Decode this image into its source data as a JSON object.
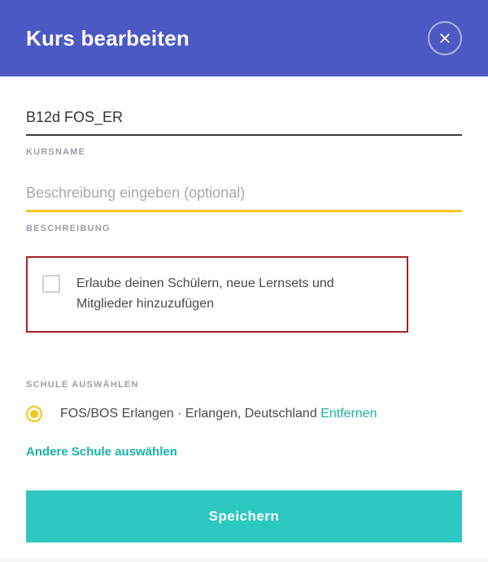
{
  "header": {
    "title": "Kurs bearbeiten"
  },
  "fields": {
    "coursename": {
      "value": "B12d FOS_ER",
      "label": "KURSNAME"
    },
    "description": {
      "value": "",
      "placeholder": "Beschreibung eingeben (optional)",
      "label": "BESCHREIBUNG"
    }
  },
  "permission": {
    "text": "Erlaube deinen Schülern, neue Lernsets und Mitglieder hinzuzufügen"
  },
  "school": {
    "section_label": "SCHULE AUSWÄHLEN",
    "name": "FOS/BOS Erlangen · Erlangen, Deutschland ",
    "remove_label": "Entfernen",
    "other_label": "Andere Schule auswählen"
  },
  "actions": {
    "save_label": "Speichern"
  }
}
